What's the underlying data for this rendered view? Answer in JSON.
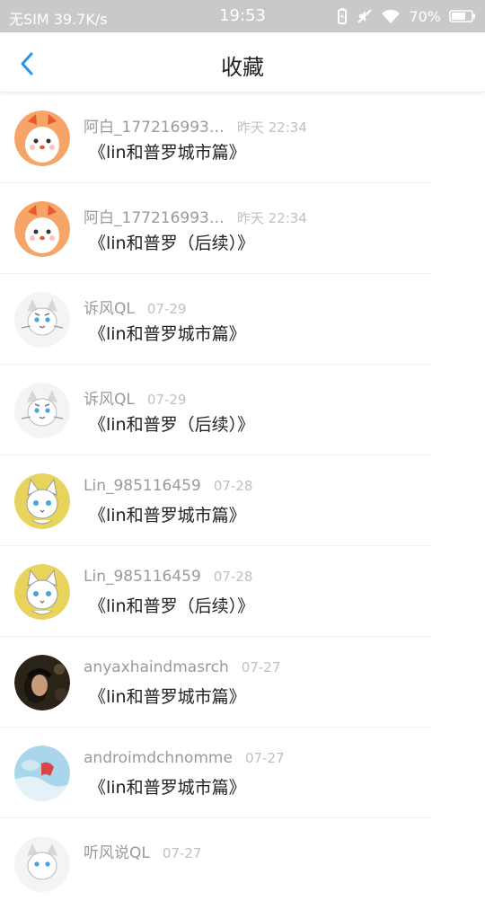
{
  "status_bar": {
    "carrier": "无SIM",
    "speed": "39.7K/s",
    "time": "19:53",
    "battery": "70%",
    "icons": [
      "battery-saver-icon",
      "mute-icon",
      "wifi-icon",
      "battery-icon"
    ]
  },
  "header": {
    "title": "收藏",
    "back_icon": "chevron-left-icon",
    "accent_color": "#2196f3"
  },
  "items": [
    {
      "username": "阿白_177216993…",
      "time": "昨天 22:34",
      "title": "《lin和普罗城市篇》",
      "avatar": "chick"
    },
    {
      "username": "阿白_177216993…",
      "time": "昨天 22:34",
      "title": "《lin和普罗（后续）》",
      "avatar": "chick"
    },
    {
      "username": "诉风QL",
      "time": "07-29",
      "title": "《lin和普罗城市篇》",
      "avatar": "tiger"
    },
    {
      "username": "诉风QL",
      "time": "07-29",
      "title": "《lin和普罗（后续）》",
      "avatar": "tiger"
    },
    {
      "username": "Lin_985116459",
      "time": "07-28",
      "title": "《lin和普罗城市篇》",
      "avatar": "fox"
    },
    {
      "username": "Lin_985116459",
      "time": "07-28",
      "title": "《lin和普罗（后续）》",
      "avatar": "fox"
    },
    {
      "username": "anyaxhaindmasrch",
      "time": "07-27",
      "title": "《lin和普罗城市篇》",
      "avatar": "photo-dark"
    },
    {
      "username": "androimdchnomme",
      "time": "07-27",
      "title": "《lin和普罗城市篇》",
      "avatar": "photo-blue"
    },
    {
      "username": "听风说QL",
      "time": "07-27",
      "title": "",
      "avatar": "tiger"
    }
  ]
}
